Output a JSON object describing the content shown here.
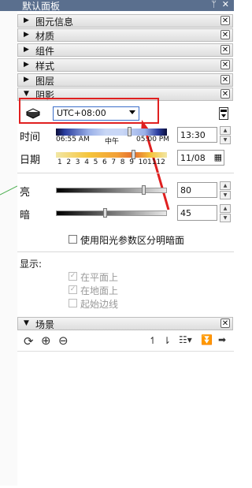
{
  "window": {
    "title": "默认面板",
    "pin_icon": "pin-icon",
    "close_icon": "close-icon"
  },
  "sections": [
    {
      "label": "图元信息",
      "expanded": false
    },
    {
      "label": "材质",
      "expanded": false
    },
    {
      "label": "组件",
      "expanded": false
    },
    {
      "label": "样式",
      "expanded": false
    },
    {
      "label": "图层",
      "expanded": false
    },
    {
      "label": "阴影",
      "expanded": true
    }
  ],
  "shadow": {
    "timezone_value": "UTC+08:00",
    "time_label": "时间",
    "time_start": "06:55 AM",
    "time_mid": "中午",
    "time_end": "05:00 PM",
    "time_value": "13:30",
    "date_label": "日期",
    "date_ticks": [
      "1",
      "2",
      "3",
      "4",
      "5",
      "6",
      "7",
      "8",
      "9",
      "10",
      "11",
      "12"
    ],
    "date_value": "11/08",
    "light_label": "亮",
    "light_value": "80",
    "dark_label": "暗",
    "dark_value": "45",
    "sun_shading_label": "使用阳光参数区分明暗面",
    "display_label": "显示:",
    "on_faces_label": "在平面上",
    "on_ground_label": "在地面上",
    "from_edges_label": "起始边线",
    "on_faces_checked": true,
    "on_ground_checked": true,
    "from_edges_checked": false
  },
  "scenes": {
    "label": "场景"
  },
  "colors": {
    "titlebar": "#5a6f8e",
    "highlight_box": "#e02020",
    "accent": "#3b6ec9"
  }
}
